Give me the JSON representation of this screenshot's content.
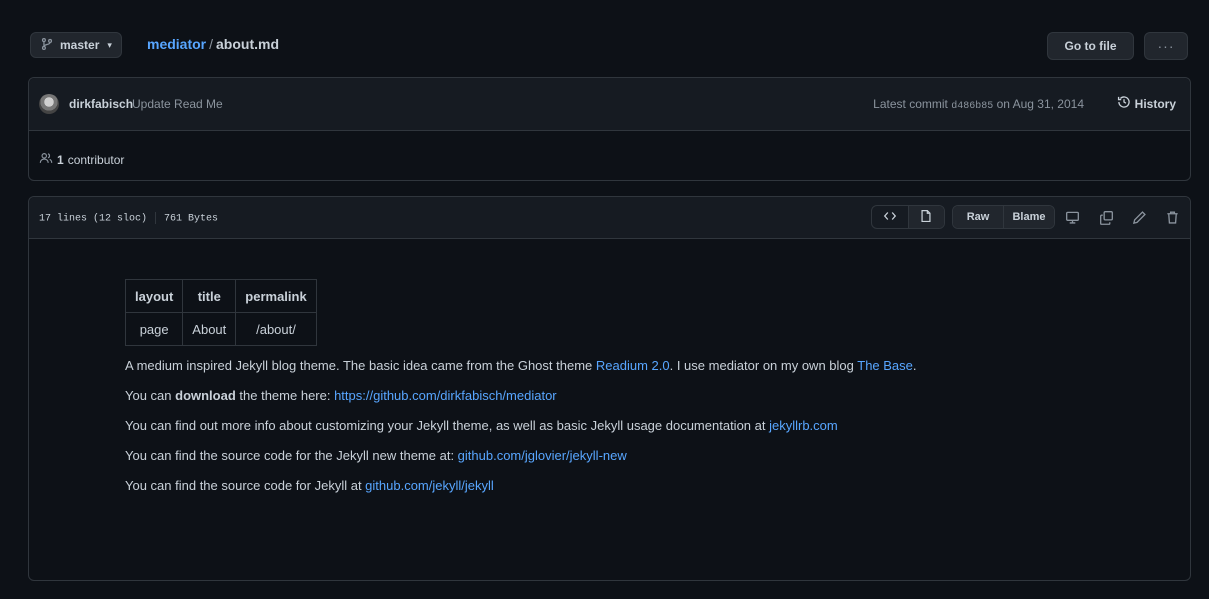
{
  "topbar": {
    "branch": "master",
    "repo": "mediator",
    "separator": "/",
    "file": "about.md",
    "goto_label": "Go to file",
    "more_label": "···"
  },
  "commit": {
    "author": "dirkfabisch",
    "message": "Update Read Me",
    "latest_label": "Latest commit",
    "sha": "d486b85",
    "date": "on Aug 31, 2014",
    "history_label": "History",
    "contributor_count": "1",
    "contributor_label": "contributor"
  },
  "file": {
    "lines": "17 lines (12 sloc)",
    "size": "761 Bytes",
    "raw_label": "Raw",
    "blame_label": "Blame"
  },
  "markdown": {
    "table": {
      "headers": [
        "layout",
        "title",
        "permalink"
      ],
      "row": [
        "page",
        "About",
        "/about/"
      ]
    },
    "p1": {
      "text_a": "A medium inspired Jekyll blog theme. The basic idea came from the Ghost theme ",
      "link_a": "Readium 2.0",
      "text_b": ". I use mediator on my own blog ",
      "link_b": "The Base",
      "text_c": "."
    },
    "p2": {
      "text_a": "You can ",
      "bold": "download",
      "text_b": " the theme here: ",
      "link": "https://github.com/dirkfabisch/mediator"
    },
    "p3": {
      "text": "You can find out more info about customizing your Jekyll theme, as well as basic Jekyll usage documentation at ",
      "link": "jekyllrb.com"
    },
    "p4": {
      "text": "You can find the source code for the Jekyll new theme at: ",
      "link": "github.com/jglovier/jekyll-new"
    },
    "p5": {
      "text": "You can find the source code for Jekyll at ",
      "link": "github.com/jekyll/jekyll"
    }
  },
  "colors": {
    "background": "#0d1117",
    "panel": "#161b22",
    "border": "#30363d",
    "link": "#58a6ff",
    "text": "#c9d1d9",
    "muted": "#8b949e"
  }
}
